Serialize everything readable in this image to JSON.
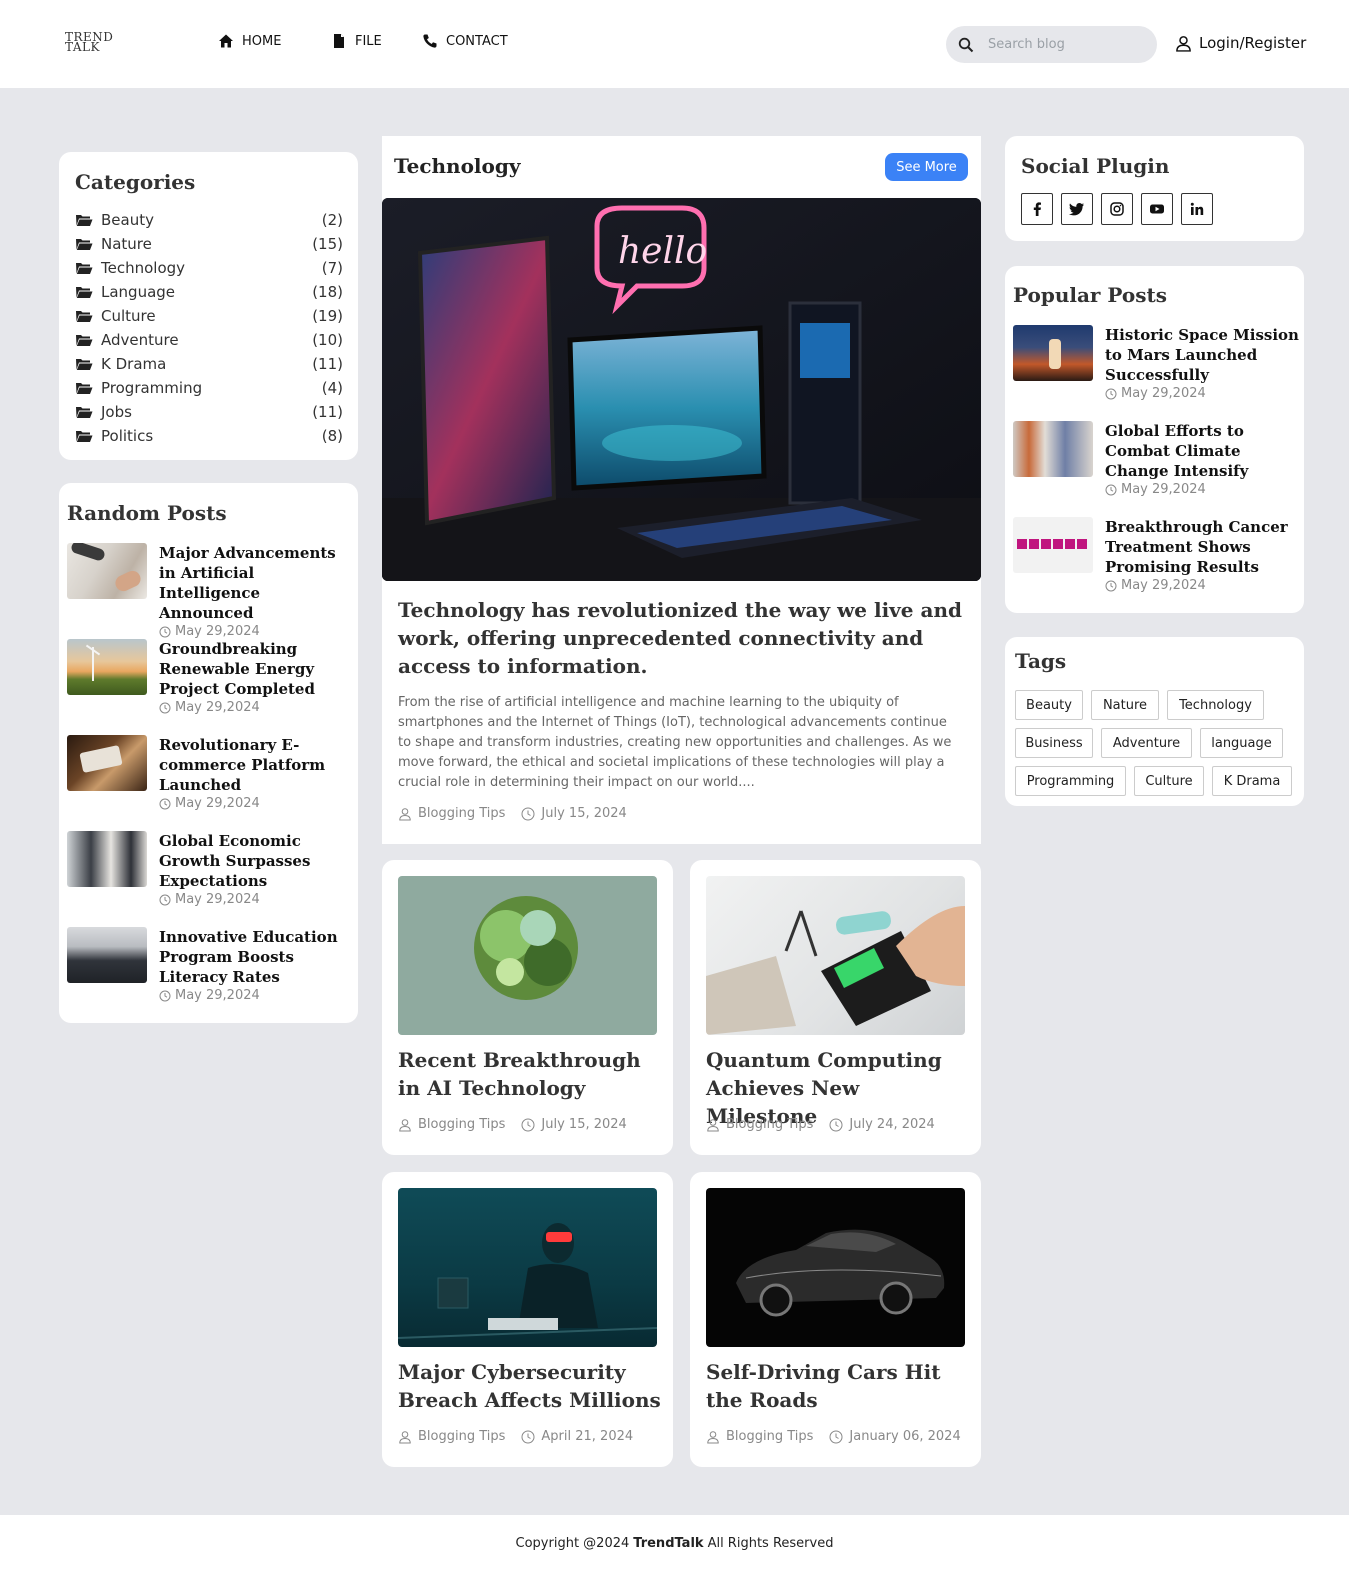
{
  "header": {
    "logo_line1": "TREND",
    "logo_line2": "TALK",
    "nav": [
      {
        "label": "HOME",
        "icon": "home-icon"
      },
      {
        "label": "FILE",
        "icon": "file-icon"
      },
      {
        "label": "CONTACT",
        "icon": "phone-icon"
      }
    ],
    "search_placeholder": "Search blog",
    "login_label": "Login/Register"
  },
  "categories": {
    "title": "Categories",
    "items": [
      {
        "name": "Beauty",
        "count": "(2)"
      },
      {
        "name": "Nature",
        "count": "(15)"
      },
      {
        "name": "Technology",
        "count": "(7)"
      },
      {
        "name": "Language",
        "count": "(18)"
      },
      {
        "name": "Culture",
        "count": "(19)"
      },
      {
        "name": "Adventure",
        "count": "(10)"
      },
      {
        "name": "K Drama",
        "count": "(11)"
      },
      {
        "name": "Programming",
        "count": "(4)"
      },
      {
        "name": "Jobs",
        "count": "(11)"
      },
      {
        "name": "Politics",
        "count": "(8)"
      }
    ]
  },
  "random_posts": {
    "title": "Random Posts",
    "items": [
      {
        "title": "Major Advancements in Artificial Intelligence Announced",
        "date": "May 29,2024"
      },
      {
        "title": "Groundbreaking Renewable Energy Project Completed",
        "date": "May 29,2024"
      },
      {
        "title": "Revolutionary E-commerce Platform Launched",
        "date": "May 29,2024"
      },
      {
        "title": "Global Economic Growth Surpasses Expectations",
        "date": "May 29,2024"
      },
      {
        "title": "Innovative Education Program Boosts Literacy Rates",
        "date": "May 29,2024"
      }
    ]
  },
  "main": {
    "section_title": "Technology",
    "see_more_label": "See More",
    "hero": {
      "image_text": "hello",
      "title": "Technology has revolutionized the way we live and work, offering unprecedented connectivity and access to information.",
      "description": "From the rise of artificial intelligence and machine learning to the ubiquity of smartphones and the Internet of Things (IoT), technological advancements continue to shape and transform industries, creating new opportunities and challenges. As we move forward, the ethical and societal implications of these technologies will play a crucial role in determining their impact on our world....",
      "author": "Blogging Tips",
      "date": "July 15, 2024"
    },
    "cards": [
      {
        "title": "Recent Breakthrough in AI Technology",
        "author": "Blogging Tips",
        "date": "July 15, 2024"
      },
      {
        "title": "Quantum Computing Achieves New Milestone",
        "author": "Blogging Tips",
        "date": "July 24, 2024"
      },
      {
        "title": "Major Cybersecurity Breach Affects Millions",
        "author": "Blogging Tips",
        "date": "April 21, 2024"
      },
      {
        "title": "Self-Driving Cars Hit the Roads",
        "author": "Blogging Tips",
        "date": "January 06, 2024"
      }
    ]
  },
  "social": {
    "title": "Social Plugin",
    "icons": [
      "facebook-icon",
      "twitter-icon",
      "instagram-icon",
      "youtube-icon",
      "linkedin-icon"
    ]
  },
  "popular_posts": {
    "title": "Popular Posts",
    "items": [
      {
        "title": "Historic Space Mission to Mars Launched Successfully",
        "date": "May 29,2024"
      },
      {
        "title": "Global Efforts to Combat Climate Change Intensify",
        "date": "May 29,2024"
      },
      {
        "title": "Breakthrough Cancer Treatment Shows Promising Results",
        "date": "May 29,2024"
      }
    ]
  },
  "tags": {
    "title": "Tags",
    "items": [
      "Beauty",
      "Nature",
      "Technology",
      "Business",
      "Adventure",
      "language",
      "Programming",
      "Culture",
      "K Drama"
    ]
  },
  "footer": {
    "prefix": "Copyright @2024",
    "brand": "TrendTalk",
    "suffix": "All Rights Reserved"
  },
  "colors": {
    "background": "#e6e7eb",
    "accent": "#3b82f6",
    "card": "#ffffff"
  }
}
